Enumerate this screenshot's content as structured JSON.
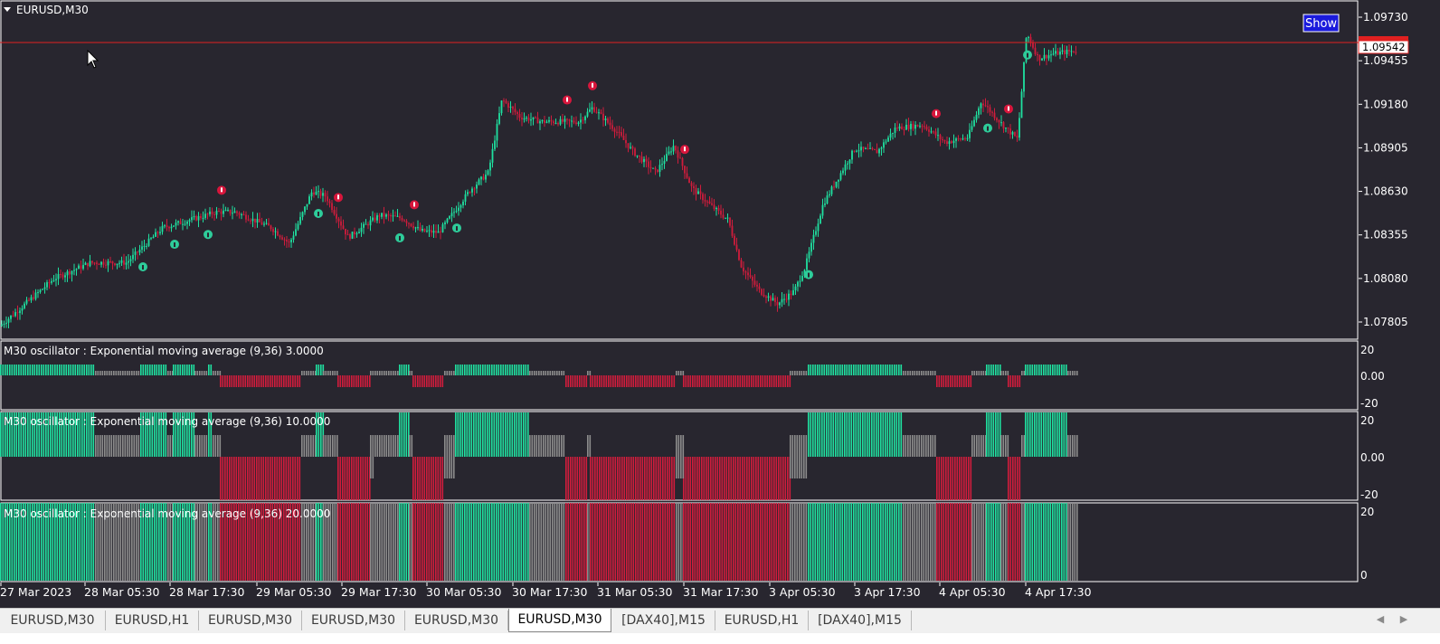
{
  "chart": {
    "symbol_title": "EURUSD,M30",
    "show_button": "Show",
    "current_price": "1.09542",
    "price_ticks": [
      "1.09730",
      "1.09455",
      "1.09180",
      "1.08905",
      "1.08630",
      "1.08355",
      "1.08080",
      "1.07805"
    ],
    "time_labels": [
      "27 Mar 2023",
      "28 Mar 05:30",
      "28 Mar 17:30",
      "29 Mar 05:30",
      "29 Mar 17:30",
      "30 Mar 05:30",
      "30 Mar 17:30",
      "31 Mar 05:30",
      "31 Mar 17:30",
      "3 Apr 05:30",
      "3 Apr 17:30",
      "4 Apr 05:30",
      "4 Apr 17:30"
    ],
    "colors": {
      "background": "#28262f",
      "bull": "#1fe0a0",
      "bear": "#d01c3c",
      "neutral": "#8c8c8c",
      "price_line": "#e02020",
      "signal_up": "#2ecc9a",
      "signal_down": "#d8163c"
    }
  },
  "indicators": [
    {
      "label": "M30  oscillator : Exponential moving average (9,36)  3.0000",
      "scale": [
        "20",
        "0.00",
        "-20"
      ]
    },
    {
      "label": "M30  oscillator : Exponential moving average (9,36)  10.0000",
      "scale": [
        "20",
        "0.00",
        "-20"
      ]
    },
    {
      "label": "M30  oscillator : Exponential moving average (9,36)  20.0000",
      "scale": [
        "20",
        "0"
      ]
    }
  ],
  "tabs": [
    {
      "label": "EURUSD,M30",
      "active": false
    },
    {
      "label": "EURUSD,H1",
      "active": false
    },
    {
      "label": "EURUSD,M30",
      "active": false
    },
    {
      "label": "EURUSD,M30",
      "active": false
    },
    {
      "label": "EURUSD,M30",
      "active": false
    },
    {
      "label": "EURUSD,M30",
      "active": true
    },
    {
      "label": "[DAX40],M15",
      "active": false
    },
    {
      "label": "EURUSD,H1",
      "active": false
    },
    {
      "label": "[DAX40],M15",
      "active": false
    }
  ],
  "chart_data": {
    "type": "candlestick",
    "price_points": [
      [
        0,
        1.0778
      ],
      [
        60,
        1.0808
      ],
      [
        100,
        1.0818
      ],
      [
        140,
        1.0818
      ],
      [
        180,
        1.084
      ],
      [
        240,
        1.085
      ],
      [
        260,
        1.085
      ],
      [
        300,
        1.084
      ],
      [
        320,
        1.083
      ],
      [
        345,
        1.0863
      ],
      [
        360,
        1.086
      ],
      [
        385,
        1.0834
      ],
      [
        420,
        1.0848
      ],
      [
        445,
        1.0846
      ],
      [
        465,
        1.0838
      ],
      [
        485,
        1.0837
      ],
      [
        520,
        1.0864
      ],
      [
        540,
        1.0875
      ],
      [
        555,
        1.0921
      ],
      [
        575,
        1.091
      ],
      [
        600,
        1.0907
      ],
      [
        640,
        1.0907
      ],
      [
        655,
        1.0916
      ],
      [
        680,
        1.0902
      ],
      [
        700,
        1.0888
      ],
      [
        725,
        1.0875
      ],
      [
        745,
        1.0892
      ],
      [
        765,
        1.0865
      ],
      [
        790,
        1.0852
      ],
      [
        805,
        1.0845
      ],
      [
        820,
        1.0815
      ],
      [
        840,
        1.08
      ],
      [
        860,
        1.0792
      ],
      [
        878,
        1.08
      ],
      [
        890,
        1.0815
      ],
      [
        910,
        1.0855
      ],
      [
        930,
        1.0875
      ],
      [
        945,
        1.089
      ],
      [
        970,
        1.0888
      ],
      [
        990,
        1.0903
      ],
      [
        1020,
        1.0905
      ],
      [
        1045,
        1.0894
      ],
      [
        1070,
        1.0897
      ],
      [
        1085,
        1.092
      ],
      [
        1110,
        1.0904
      ],
      [
        1125,
        1.0896
      ],
      [
        1135,
        1.0963
      ],
      [
        1148,
        1.0947
      ],
      [
        1165,
        1.095
      ],
      [
        1190,
        1.0952
      ]
    ],
    "signals_up_x": [
      158,
      193,
      230,
      352,
      442,
      505,
      894,
      1092,
      1136
    ],
    "signals_down_x": [
      245,
      374,
      458,
      627,
      655,
      757,
      1035,
      1115
    ],
    "osc_sequence": [
      [
        "G",
        0,
        105
      ],
      [
        "N",
        105,
        155
      ],
      [
        "G",
        155,
        185
      ],
      [
        "N",
        185,
        191
      ],
      [
        "G",
        191,
        215
      ],
      [
        "N",
        215,
        230
      ],
      [
        "G",
        230,
        235
      ],
      [
        "N",
        235,
        243
      ],
      [
        "R",
        243,
        333
      ],
      [
        "N",
        333,
        349
      ],
      [
        "G",
        349,
        357
      ],
      [
        "N",
        357,
        373
      ],
      [
        "R",
        373,
        409
      ],
      [
        "N",
        409,
        441
      ],
      [
        "G",
        441,
        452
      ],
      [
        "N",
        452,
        456
      ],
      [
        "R",
        456,
        491
      ],
      [
        "N",
        491,
        503
      ],
      [
        "G",
        503,
        585
      ],
      [
        "N",
        585,
        625
      ],
      [
        "R",
        625,
        649
      ],
      [
        "N",
        649,
        652
      ],
      [
        "R",
        652,
        747
      ],
      [
        "N",
        747,
        755
      ],
      [
        "R",
        755,
        873
      ],
      [
        "N",
        873,
        893
      ],
      [
        "G",
        893,
        998
      ],
      [
        "N",
        998,
        1035
      ],
      [
        "R",
        1035,
        1074
      ],
      [
        "N",
        1074,
        1090
      ],
      [
        "G",
        1090,
        1106
      ],
      [
        "N",
        1106,
        1114
      ],
      [
        "R",
        1114,
        1129
      ],
      [
        "N",
        1129,
        1133
      ],
      [
        "G",
        1133,
        1180
      ],
      [
        "N",
        1180,
        1192
      ]
    ]
  }
}
